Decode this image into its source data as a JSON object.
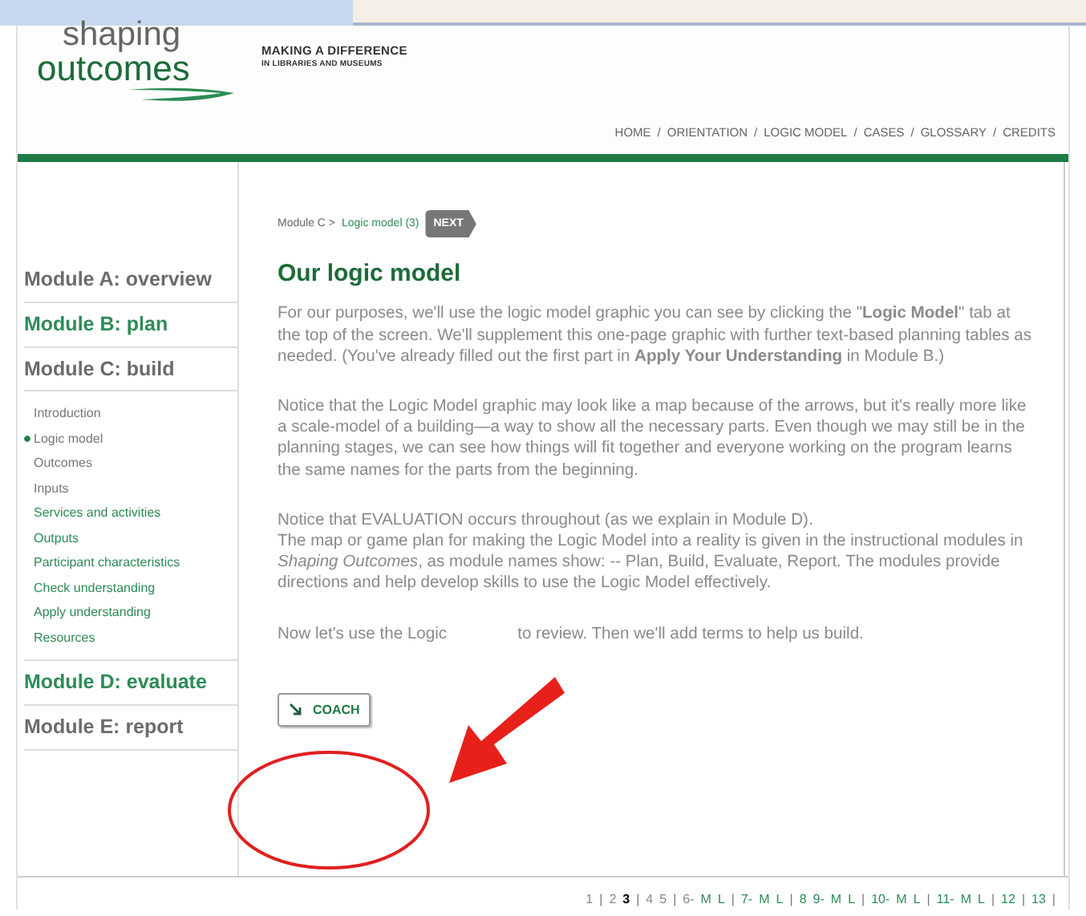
{
  "header": {
    "logo_top": "shaping",
    "logo_bottom": "outcomes",
    "tagline": "MAKING A DIFFERENCE",
    "subtagline": "IN LIBRARIES AND MUSEUMS",
    "nav": [
      "HOME",
      "ORIENTATION",
      "LOGIC MODEL",
      "CASES",
      "GLOSSARY",
      "CREDITS"
    ],
    "nav_separator": "/"
  },
  "sidebar": {
    "modules": [
      {
        "label": "Module A: overview",
        "color": "#6b6b6b"
      },
      {
        "label": "Module B: plan",
        "color": "#2e8b57"
      },
      {
        "label": "Module C: build",
        "color": "#6b6b6b",
        "children": [
          {
            "label": "Introduction",
            "color": "#777777",
            "selected": false
          },
          {
            "label": "Logic model",
            "color": "#777777",
            "selected": true
          },
          {
            "label": "Outcomes",
            "color": "#777777",
            "selected": false
          },
          {
            "label": "Inputs",
            "color": "#777777",
            "selected": false
          },
          {
            "label": "Services and activities",
            "color": "#2e8b57",
            "selected": false
          },
          {
            "label": "Outputs",
            "color": "#2e8b57",
            "selected": false
          },
          {
            "label": "Participant characteristics",
            "color": "#2e8b57",
            "selected": false
          },
          {
            "label": "Check understanding",
            "color": "#2e8b57",
            "selected": false
          },
          {
            "label": "Apply understanding",
            "color": "#2e8b57",
            "selected": false
          },
          {
            "label": "Resources",
            "color": "#2e8b57",
            "selected": false
          }
        ]
      },
      {
        "label": "Module D: evaluate",
        "color": "#2e8b57"
      },
      {
        "label": "Module E: report",
        "color": "#6b6b6b"
      }
    ]
  },
  "breadcrumb": {
    "parent": "Module C >",
    "current": "Logic model (3)",
    "next_button": "NEXT"
  },
  "title": "Our logic model",
  "paragraphs": [
    "For our purposes, we'll use the logic model graphic  you can see by clicking the \"**Logic Model**\" tab at the top of the screen. We'll supplement this one-page graphic with further text-based planning tables as needed. (You've already filled out the first part in **Apply Your Understanding** in Module B.)",
    "Notice that the Logic Model graphic may look like a map because of the arrows, but it's really more like a scale-model of a building—a way to show all the necessary parts. Even though we may still be in the planning stages, we can see how things will fit together and everyone working on the program learns the same names for the parts from the beginning.",
    "Notice that EVALUATION occurs throughout (as we explain in Module D).",
    "The map or game plan for making the Logic Model into a reality is given in the instructional modules in *Shaping Outcomes*, as module names show: -- Plan, Build, Evaluate, Report. The modules provide directions and help develop skills to use the Logic Model effectively."
  ],
  "last_line": {
    "before_arrow": "Now let's use the Logic",
    "after_arrow": "to review. Then we'll add terms to help us build."
  },
  "coach_button": "COACH",
  "pager": [
    {
      "label": "1",
      "kind": "page",
      "selected": false
    },
    {
      "label": "|",
      "kind": "sep"
    },
    {
      "label": "2",
      "kind": "page",
      "selected": false
    },
    {
      "label": "3",
      "kind": "page",
      "selected": true
    },
    {
      "label": "|",
      "kind": "sep"
    },
    {
      "label": "4",
      "kind": "page",
      "selected": false
    },
    {
      "label": "5",
      "kind": "page",
      "selected": false
    },
    {
      "label": "|",
      "kind": "sep"
    },
    {
      "label": "6-",
      "kind": "page",
      "selected": false
    },
    {
      "label": "M",
      "kind": "link",
      "selected": false
    },
    {
      "label": "L",
      "kind": "link",
      "selected": false
    },
    {
      "label": "|",
      "kind": "sep"
    },
    {
      "label": "7-",
      "kind": "link",
      "selected": false
    },
    {
      "label": "M",
      "kind": "link",
      "selected": false
    },
    {
      "label": "L",
      "kind": "link",
      "selected": false
    },
    {
      "label": "|",
      "kind": "sep"
    },
    {
      "label": "8",
      "kind": "link",
      "selected": false
    },
    {
      "label": "9-",
      "kind": "link",
      "selected": false
    },
    {
      "label": "M",
      "kind": "link",
      "selected": false
    },
    {
      "label": "L",
      "kind": "link",
      "selected": false
    },
    {
      "label": "|",
      "kind": "sep"
    },
    {
      "label": "10-",
      "kind": "link",
      "selected": false
    },
    {
      "label": "M",
      "kind": "link",
      "selected": false
    },
    {
      "label": "L",
      "kind": "link",
      "selected": false
    },
    {
      "label": "|",
      "kind": "sep"
    },
    {
      "label": "11-",
      "kind": "link",
      "selected": false
    },
    {
      "label": "M",
      "kind": "link",
      "selected": false
    },
    {
      "label": "L",
      "kind": "link",
      "selected": false
    },
    {
      "label": "|",
      "kind": "sep"
    },
    {
      "label": "12",
      "kind": "link",
      "selected": false
    },
    {
      "label": "|",
      "kind": "sep"
    },
    {
      "label": "13",
      "kind": "link",
      "selected": false
    },
    {
      "label": "|",
      "kind": "sep"
    }
  ]
}
